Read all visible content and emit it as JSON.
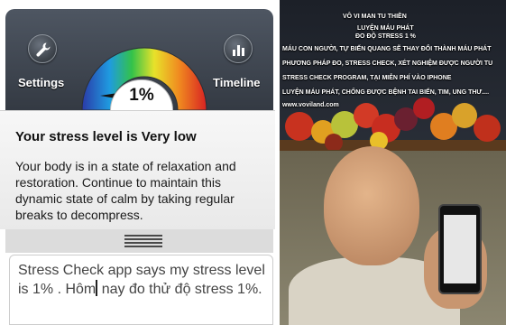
{
  "left_app": {
    "settings_label": "Settings",
    "timeline_label": "Timeline",
    "stress_percent": "1%",
    "stress_level": 0.01,
    "card_title": "Your stress level is Very low",
    "card_body": "Your body is in a state of relaxation and restoration. Continue to maintain this dynamic state of calm by taking regular breaks to decompress.",
    "note_text_before": "Stress Check app says my stress level is 1% . Hôm",
    "note_text_after": " nay đo thử độ stress 1%.",
    "icons": {
      "settings": "wrench-icon",
      "timeline": "bar-chart-icon"
    }
  },
  "right_photo": {
    "lines": [
      "VÔ VI MAN TU THIỀN",
      "LUYỆN MÁU PHÁT",
      "ĐO ĐỘ STRESS 1 %",
      "MÁU CON NGƯỜI, TỰ BIẾN QUANG SẼ THAY ĐỔI THÀNH MÁU PHÁT",
      "PHƯƠNG PHÁP ĐO, STRESS CHECK, XÉT NGHIỆM ĐƯỢC NGƯỜI TU",
      "STRESS CHECK PROGRAM, TẠI MIỄN PHÍ VÀO IPHONE",
      "LUYỆN MÁU PHÁT, CHỐNG ĐƯỢC BỆNH TAI BIẾN, TIM, UNG THƯ....",
      "www.voviland.com"
    ]
  }
}
